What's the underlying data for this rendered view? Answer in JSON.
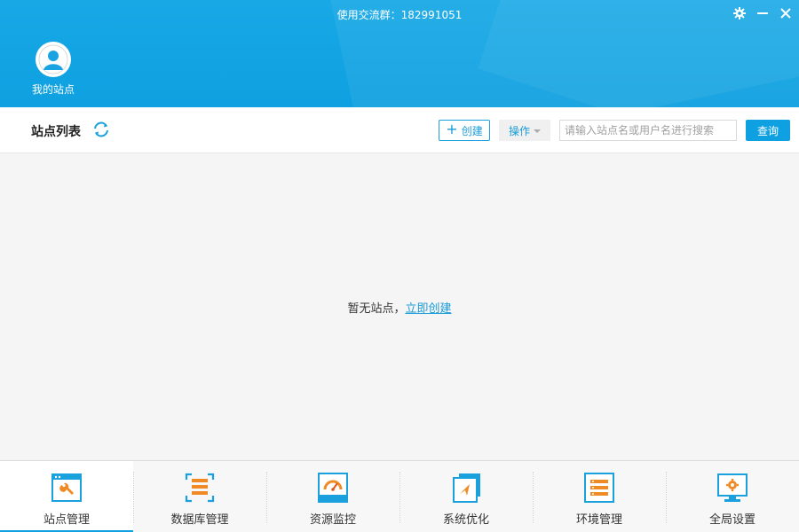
{
  "header": {
    "title": "使用交流群：182991051",
    "avatar_label": "我的站点",
    "controls": [
      "gear-icon",
      "minimize-icon",
      "close-icon"
    ]
  },
  "toolbar": {
    "list_title": "站点列表",
    "create_label": "创建",
    "ops_label": "操作",
    "search_placeholder": "请输入站点名或用户名进行搜索",
    "query_label": "查询"
  },
  "content": {
    "empty_text": "暂无站点，",
    "create_link": "立即创建"
  },
  "bottom_nav": [
    {
      "label": "站点管理",
      "icon": "site-manage-icon",
      "active": true
    },
    {
      "label": "数据库管理",
      "icon": "database-icon",
      "active": false
    },
    {
      "label": "资源监控",
      "icon": "monitor-gauge-icon",
      "active": false
    },
    {
      "label": "系统优化",
      "icon": "optimize-icon",
      "active": false
    },
    {
      "label": "环境管理",
      "icon": "environment-icon",
      "active": false
    },
    {
      "label": "全局设置",
      "icon": "settings-monitor-icon",
      "active": false
    }
  ],
  "colors": {
    "primary": "#0ea0e0",
    "link": "#1a9bd7",
    "accent_orange": "#f08a24"
  }
}
